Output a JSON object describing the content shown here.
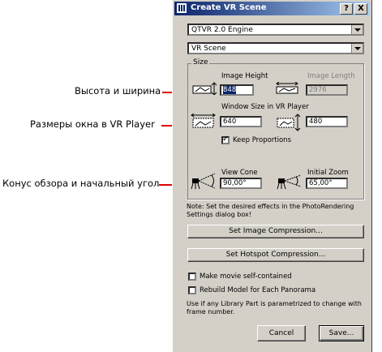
{
  "annotations": {
    "height_width": "Высота и ширина",
    "window_size": "Размеры окна в VR Player",
    "view_cone": "Конус обзора и начальный угол"
  },
  "dialog": {
    "title": "Create VR Scene",
    "help_button": "?",
    "close_button": "X",
    "engine_value": "QTVR 2.0 Engine",
    "scene_value": "VR Scene",
    "size_group": "Size",
    "image_height_label": "Image Height",
    "image_length_label": "Image Length",
    "image_height_value": "848",
    "image_length_value": "2976",
    "window_size_label": "Window Size in VR Player",
    "window_width_value": "640",
    "window_height_value": "480",
    "keep_proportions_label": "Keep Proportions",
    "keep_proportions_checked": true,
    "view_cone_label": "View Cone",
    "view_cone_value": "90,00°",
    "initial_zoom_label": "Initial Zoom",
    "initial_zoom_value": "65,00°",
    "note": "Note: Set the desired effects in the PhotoRendering Settings dialog box!",
    "set_image_compression": "Set Image Compression...",
    "set_hotspot_compression": "Set Hotspot Compression...",
    "self_contained_label": "Make movie self-contained",
    "rebuild_model_label": "Rebuild Model for Each Panorama",
    "library_note": "Use if any Library Part is parametrized to change with frame number.",
    "cancel": "Cancel",
    "save": "Save..."
  }
}
